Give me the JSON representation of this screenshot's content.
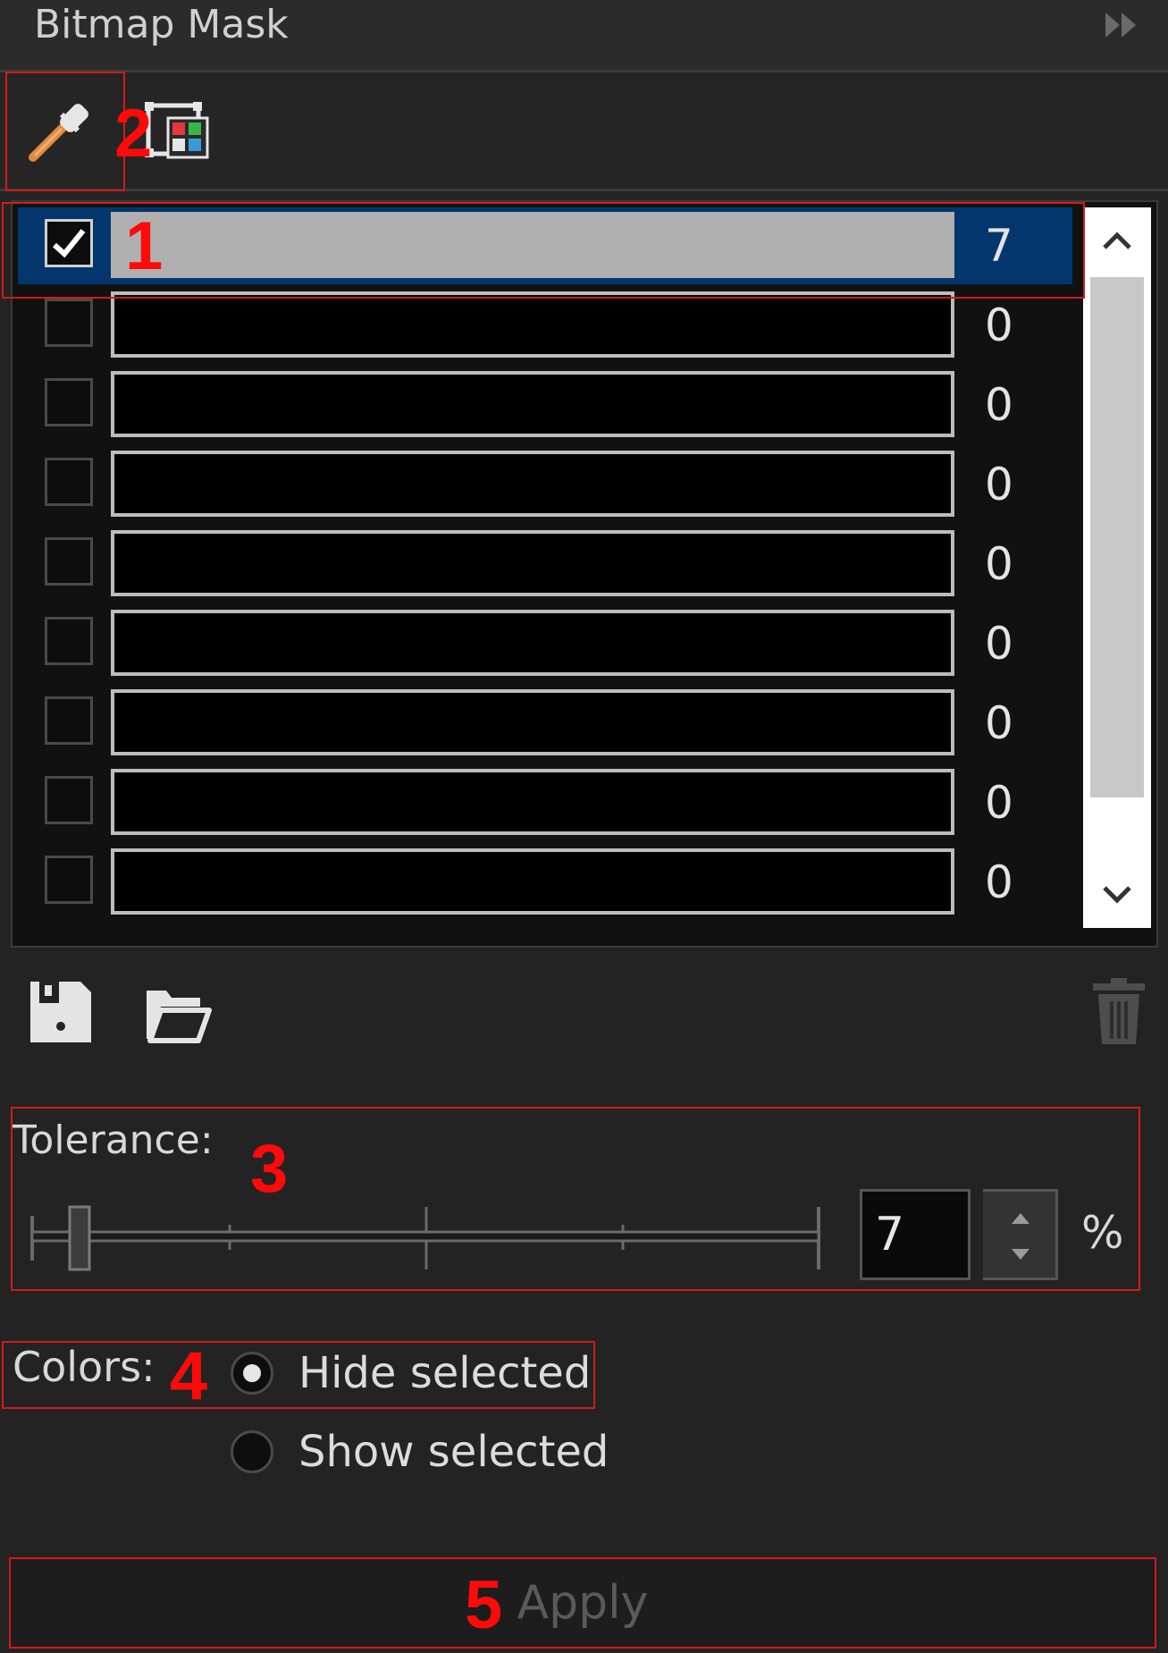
{
  "panel": {
    "title": "Bitmap Mask"
  },
  "list": {
    "rows": [
      {
        "checked": true,
        "count": "7",
        "selected": true
      },
      {
        "checked": false,
        "count": "0"
      },
      {
        "checked": false,
        "count": "0"
      },
      {
        "checked": false,
        "count": "0"
      },
      {
        "checked": false,
        "count": "0"
      },
      {
        "checked": false,
        "count": "0"
      },
      {
        "checked": false,
        "count": "0"
      },
      {
        "checked": false,
        "count": "0"
      },
      {
        "checked": false,
        "count": "0"
      }
    ]
  },
  "tolerance": {
    "label": "Tolerance:",
    "value": "7",
    "unit": "%"
  },
  "colors": {
    "label": "Colors:",
    "options": [
      "Hide selected",
      "Show selected"
    ],
    "selected": "Hide selected"
  },
  "apply": {
    "label": "Apply"
  },
  "annotations": [
    "1",
    "2",
    "3",
    "4",
    "5"
  ]
}
